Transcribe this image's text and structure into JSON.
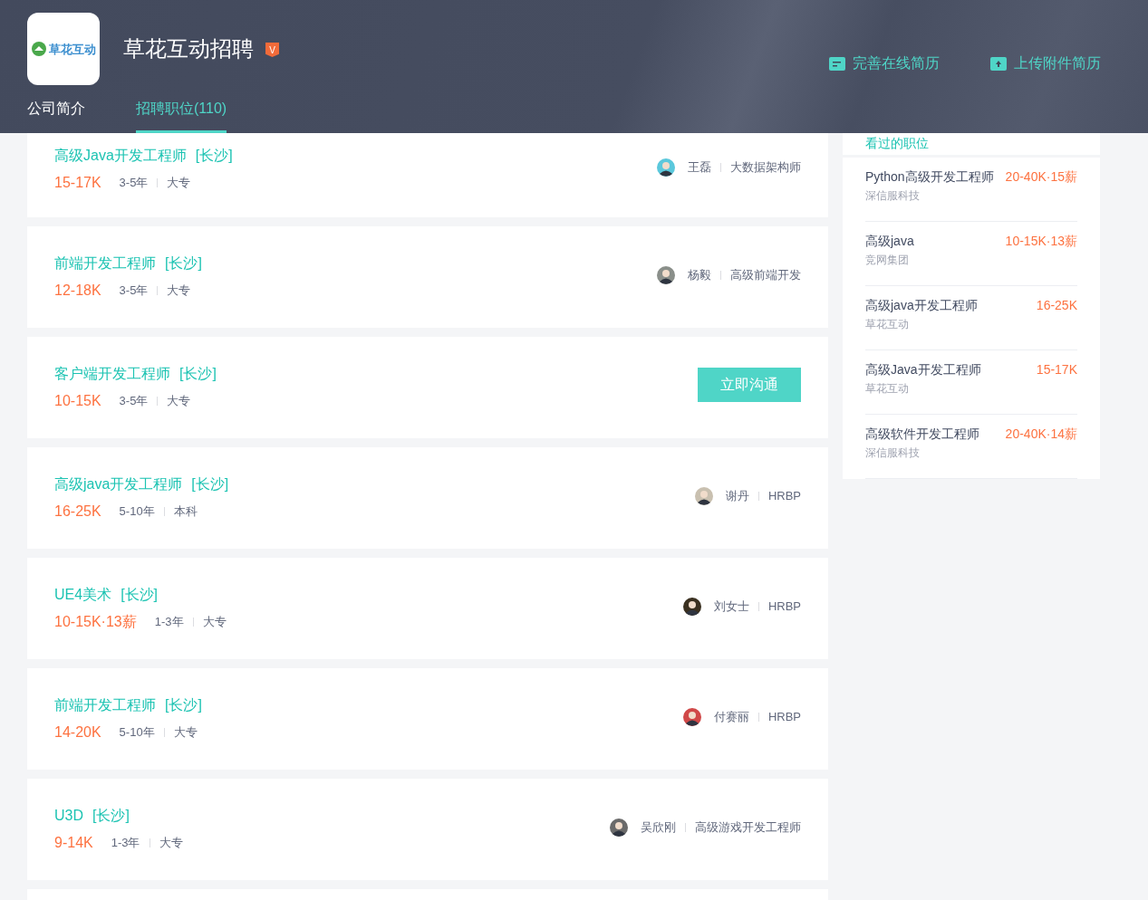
{
  "header": {
    "logo_text": "草花互动",
    "company": "草花互动招聘",
    "verified_badge": "V",
    "tabs": [
      {
        "label": "公司简介",
        "selected": false
      },
      {
        "label": "招聘职位(110)",
        "selected": true
      }
    ],
    "actions": [
      {
        "kind": "resume",
        "label": "完善在线简历"
      },
      {
        "kind": "upload",
        "label": "上传附件简历"
      }
    ]
  },
  "jobs": [
    {
      "title": "高级Java开发工程师",
      "city": "[长沙]",
      "salary": "15-17K",
      "experience": "3-5年",
      "education": "大专",
      "contact": {
        "kind": "recruiter",
        "name": "王磊",
        "role": "大数据架构师"
      }
    },
    {
      "title": "前端开发工程师",
      "city": "[长沙]",
      "salary": "12-18K",
      "experience": "3-5年",
      "education": "大专",
      "contact": {
        "kind": "recruiter",
        "name": "杨毅",
        "role": "高级前端开发"
      }
    },
    {
      "title": "客户端开发工程师",
      "city": "[长沙]",
      "salary": "10-15K",
      "experience": "3-5年",
      "education": "大专",
      "contact": {
        "kind": "button",
        "label": "立即沟通"
      }
    },
    {
      "title": "高级java开发工程师",
      "city": "[长沙]",
      "salary": "16-25K",
      "experience": "5-10年",
      "education": "本科",
      "contact": {
        "kind": "recruiter",
        "name": "谢丹",
        "role": "HRBP"
      }
    },
    {
      "title": "UE4美术",
      "city": "[长沙]",
      "salary": "10-15K·13薪",
      "experience": "1-3年",
      "education": "大专",
      "contact": {
        "kind": "recruiter",
        "name": "刘女士",
        "role": "HRBP"
      }
    },
    {
      "title": "前端开发工程师",
      "city": "[长沙]",
      "salary": "14-20K",
      "experience": "5-10年",
      "education": "大专",
      "contact": {
        "kind": "recruiter",
        "name": "付赛丽",
        "role": "HRBP"
      }
    },
    {
      "title": "U3D",
      "city": "[长沙]",
      "salary": "9-14K",
      "experience": "1-3年",
      "education": "大专",
      "contact": {
        "kind": "recruiter",
        "name": "吴欣刚",
        "role": "高级游戏开发工程师"
      }
    }
  ],
  "viewed": {
    "title": "看过的职位",
    "items": [
      {
        "title": "Python高级开发工程师",
        "salary": "20-40K·15薪",
        "company": "深信服科技"
      },
      {
        "title": "高级java",
        "salary": "10-15K·13薪",
        "company": "竞网集团"
      },
      {
        "title": "高级java开发工程师",
        "salary": "16-25K",
        "company": "草花互动"
      },
      {
        "title": "高级Java开发工程师",
        "salary": "15-17K",
        "company": "草花互动"
      },
      {
        "title": "高级软件开发工程师",
        "salary": "20-40K·14薪",
        "company": "深信服科技"
      }
    ]
  }
}
